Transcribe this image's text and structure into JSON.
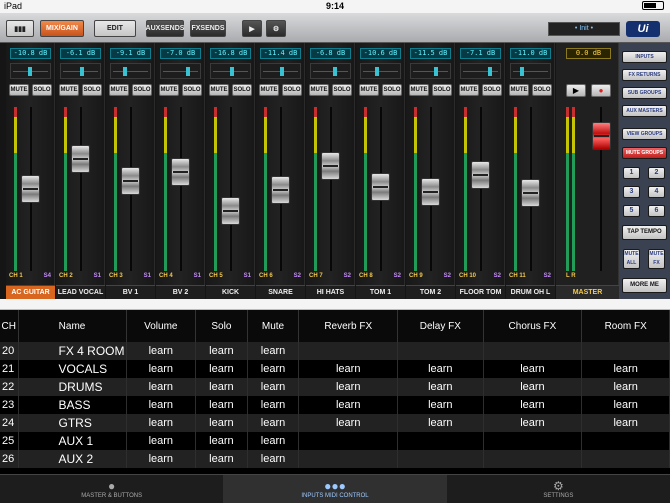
{
  "status": {
    "device": "iPad",
    "time": "9:14"
  },
  "toolbar": {
    "mix_gain": "MIX/GAIN",
    "edit": "EDIT",
    "aux_sends": "AUXSENDS",
    "fx_sends": "FXSENDS",
    "play": "▶",
    "settings": "⚙",
    "snapshot": "• Init •",
    "logo": "Ui"
  },
  "channels": [
    {
      "db": "-10.8 dB",
      "mute": "MUTE",
      "solo": "SOLO",
      "ch": "CH 1",
      "send": "S4",
      "name": "AC GUITAR",
      "fader": 0.55,
      "pan": 0.45,
      "selected": true
    },
    {
      "db": "-6.1 dB",
      "mute": "MUTE",
      "solo": "SOLO",
      "ch": "CH 2",
      "send": "S1",
      "name": "LEAD VOCAL",
      "fader": 0.75,
      "pan": 0.5,
      "selected": false
    },
    {
      "db": "-9.1 dB",
      "mute": "MUTE",
      "solo": "SOLO",
      "ch": "CH 3",
      "send": "S1",
      "name": "BV 1",
      "fader": 0.6,
      "pan": 0.3,
      "selected": false
    },
    {
      "db": "-7.0 dB",
      "mute": "MUTE",
      "solo": "SOLO",
      "ch": "CH 4",
      "send": "S1",
      "name": "BV 2",
      "fader": 0.66,
      "pan": 0.7,
      "selected": false
    },
    {
      "db": "-16.8 dB",
      "mute": "MUTE",
      "solo": "SOLO",
      "ch": "CH 5",
      "send": "S1",
      "name": "KICK",
      "fader": 0.4,
      "pan": 0.5,
      "selected": false
    },
    {
      "db": "-11.4 dB",
      "mute": "MUTE",
      "solo": "SOLO",
      "ch": "CH 6",
      "send": "S2",
      "name": "SNARE",
      "fader": 0.54,
      "pan": 0.5,
      "selected": false
    },
    {
      "db": "-6.8 dB",
      "mute": "MUTE",
      "solo": "SOLO",
      "ch": "CH 7",
      "send": "S2",
      "name": "HI HATS",
      "fader": 0.7,
      "pan": 0.6,
      "selected": false
    },
    {
      "db": "-10.6 dB",
      "mute": "MUTE",
      "solo": "SOLO",
      "ch": "CH 8",
      "send": "S2",
      "name": "TOM 1",
      "fader": 0.56,
      "pan": 0.35,
      "selected": false
    },
    {
      "db": "-11.5 dB",
      "mute": "MUTE",
      "solo": "SOLO",
      "ch": "CH 9",
      "send": "S2",
      "name": "TOM 2",
      "fader": 0.53,
      "pan": 0.65,
      "selected": false
    },
    {
      "db": "-7.1 dB",
      "mute": "MUTE",
      "solo": "SOLO",
      "ch": "CH 10",
      "send": "S2",
      "name": "FLOOR TOM",
      "fader": 0.64,
      "pan": 0.75,
      "selected": false
    },
    {
      "db": "-11.0 dB",
      "mute": "MUTE",
      "solo": "SOLO",
      "ch": "CH 11",
      "send": "S2",
      "name": "DRUM OH L",
      "fader": 0.52,
      "pan": 0.2,
      "selected": false
    }
  ],
  "master": {
    "db": "0.0 dB",
    "play": "▶",
    "record": "●",
    "ch": "L  R",
    "name": "MASTER",
    "fader": 0.9,
    "partial_name": "D"
  },
  "right_panel": {
    "inputs": "INPUTS",
    "fx_returns": "FX RETURNS",
    "sub_groups": "SUB GROUPS",
    "aux_masters": "AUX MASTERS",
    "view_groups": "VIEW GROUPS",
    "mute_groups": "MUTE GROUPS",
    "nums": [
      "1",
      "2",
      "3",
      "4",
      "5",
      "6"
    ],
    "tap_tempo": "TAP TEMPO",
    "mute_all": "MUTE ALL",
    "mute_fx": "MUTE FX",
    "more_me": "MORE ME"
  },
  "table": {
    "headers": [
      "CH",
      "Name",
      "Volume",
      "Solo",
      "Mute",
      "Reverb FX",
      "Delay FX",
      "Chorus FX",
      "Room FX"
    ],
    "rows": [
      [
        "20",
        "FX 4 ROOM",
        "learn",
        "learn",
        "learn",
        "",
        "",
        "",
        ""
      ],
      [
        "21",
        "VOCALS",
        "learn",
        "learn",
        "learn",
        "learn",
        "learn",
        "learn",
        "learn"
      ],
      [
        "22",
        "DRUMS",
        "learn",
        "learn",
        "learn",
        "learn",
        "learn",
        "learn",
        "learn"
      ],
      [
        "23",
        "BASS",
        "learn",
        "learn",
        "learn",
        "learn",
        "learn",
        "learn",
        "learn"
      ],
      [
        "24",
        "GTRS",
        "learn",
        "learn",
        "learn",
        "learn",
        "learn",
        "learn",
        "learn"
      ],
      [
        "25",
        "AUX 1",
        "learn",
        "learn",
        "learn",
        "",
        "",
        "",
        ""
      ],
      [
        "26",
        "AUX 2",
        "learn",
        "learn",
        "learn",
        "",
        "",
        "",
        ""
      ]
    ]
  },
  "tabs": [
    {
      "label": "MASTER & BUTTONS",
      "icon": "person-icon"
    },
    {
      "label": "INPUTS MIDI CONTROL",
      "icon": "group-icon"
    },
    {
      "label": "SETTINGS",
      "icon": "gear-icon"
    }
  ]
}
